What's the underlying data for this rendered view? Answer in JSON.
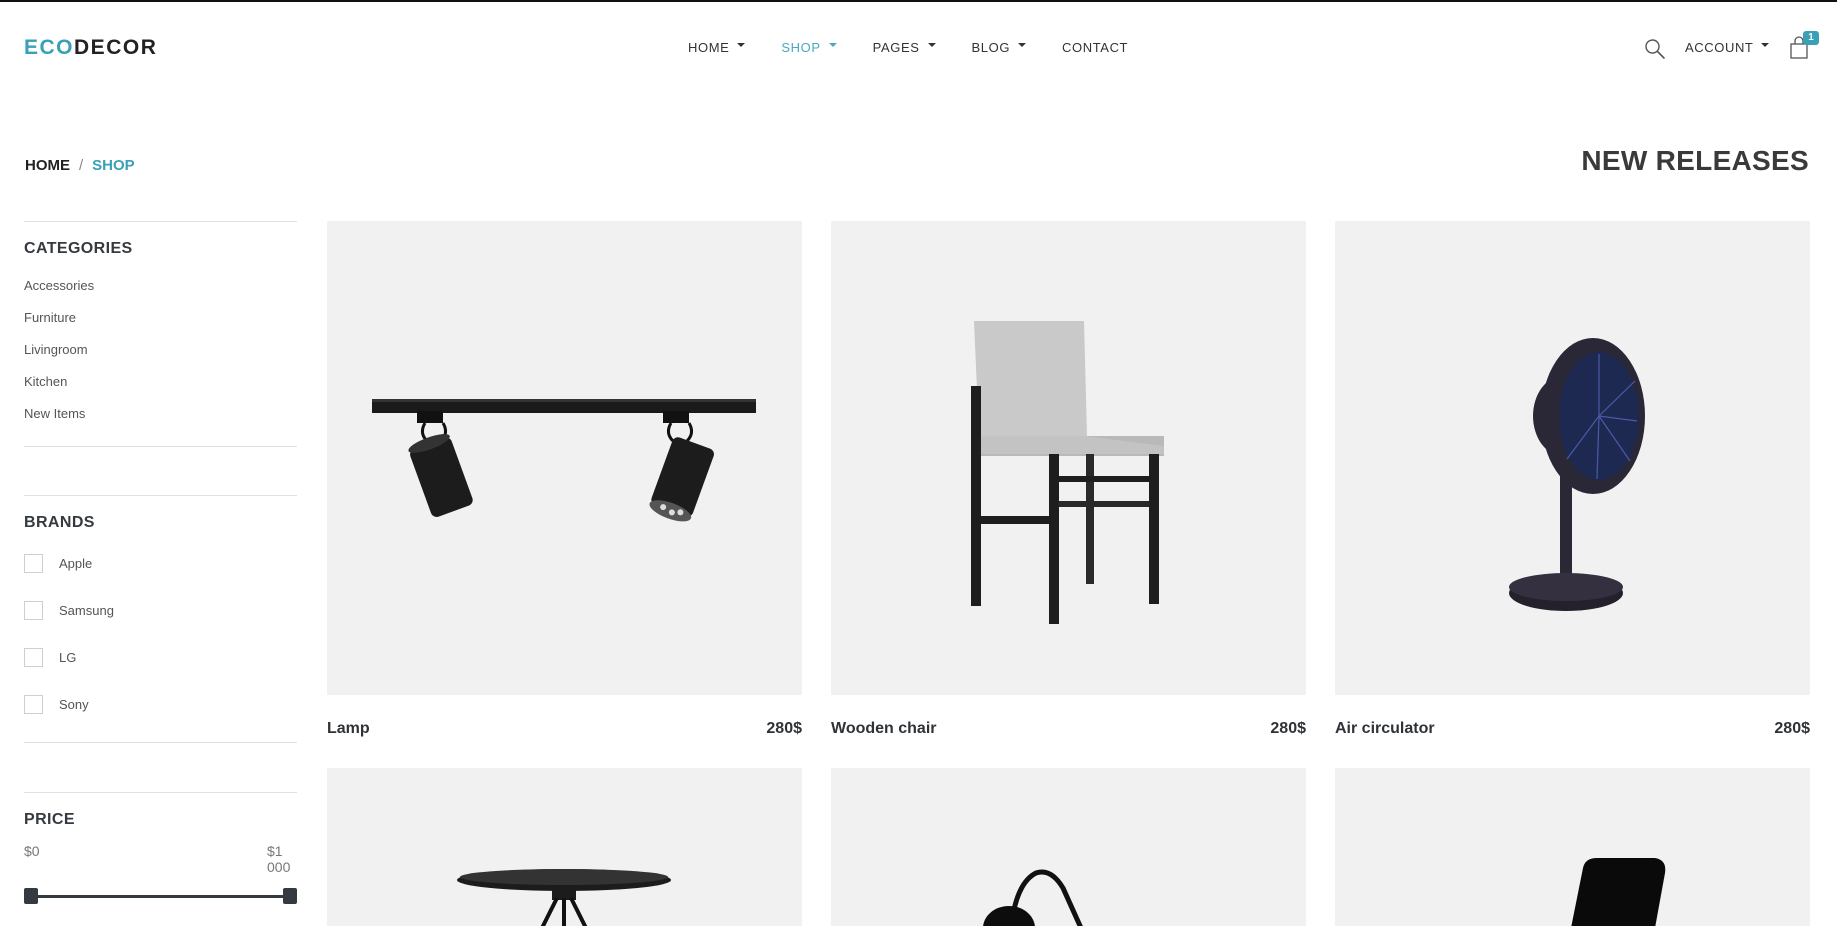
{
  "header": {
    "logo_prefix": "ECO",
    "logo_suffix": "DECOR",
    "nav": [
      {
        "label": "HOME",
        "dropdown": true
      },
      {
        "label": "SHOP",
        "dropdown": true,
        "active": true
      },
      {
        "label": "PAGES",
        "dropdown": true
      },
      {
        "label": "BLOG",
        "dropdown": true
      },
      {
        "label": "CONTACT",
        "dropdown": false
      }
    ],
    "account_label": "ACCOUNT",
    "cart_count": "1",
    "search_icon": "search-icon",
    "cart_icon": "shopping-bag-icon"
  },
  "breadcrumb": {
    "home": "HOME",
    "separator": "/",
    "current": "SHOP"
  },
  "page_title": "NEW RELEASES",
  "sidebar": {
    "categories_title": "CATEGORIES",
    "categories": [
      "Accessories",
      "Furniture",
      "Livingroom",
      "Kitchen",
      "New Items"
    ],
    "brands_title": "BRANDS",
    "brands": [
      "Apple",
      "Samsung",
      "LG",
      "Sony"
    ],
    "price_title": "PRICE",
    "price_min": "$0",
    "price_max": "$1 000"
  },
  "products": [
    {
      "name": "Lamp",
      "price": "280$",
      "image": "track-spotlight-lamp"
    },
    {
      "name": "Wooden chair",
      "price": "280$",
      "image": "chair"
    },
    {
      "name": "Air circulator",
      "price": "280$",
      "image": "desk-fan"
    }
  ],
  "products_partial": [
    {
      "image": "side-table"
    },
    {
      "image": "desk-lamp"
    },
    {
      "image": "phone"
    }
  ],
  "colors": {
    "accent": "#3aa0b5",
    "text_dark": "#2f3337",
    "image_bg": "#f1f1f1"
  }
}
